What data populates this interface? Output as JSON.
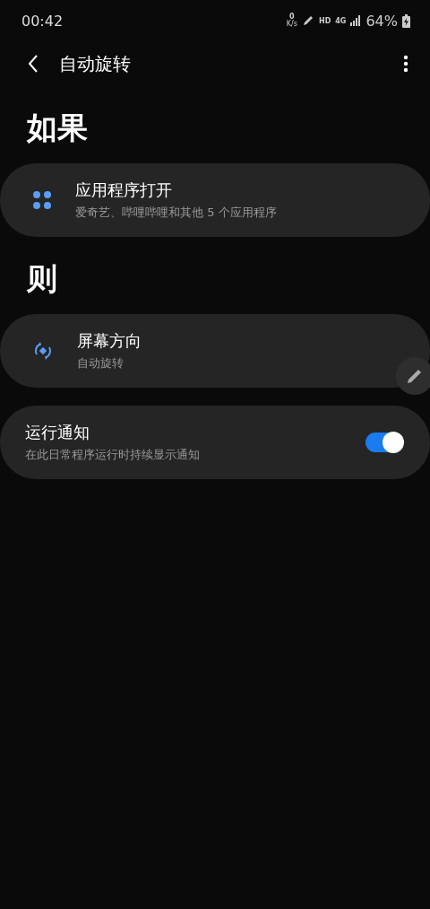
{
  "status_bar": {
    "time": "00:42",
    "speed_value": "0",
    "speed_unit": "K/s",
    "hd": "HD",
    "network": "4G",
    "battery": "64%"
  },
  "header": {
    "title": "自动旋转"
  },
  "if_section": {
    "heading": "如果",
    "items": [
      {
        "kind": "apps",
        "title": "应用程序打开",
        "subtitle": "爱奇艺、哔哩哔哩和其他 5 个应用程序"
      }
    ]
  },
  "then_section": {
    "heading": "则",
    "items": [
      {
        "kind": "rotate",
        "title": "屏幕方向",
        "subtitle": "自动旋转"
      }
    ]
  },
  "notification": {
    "title": "运行通知",
    "subtitle": "在此日常程序运行时持续显示通知",
    "on": true
  }
}
